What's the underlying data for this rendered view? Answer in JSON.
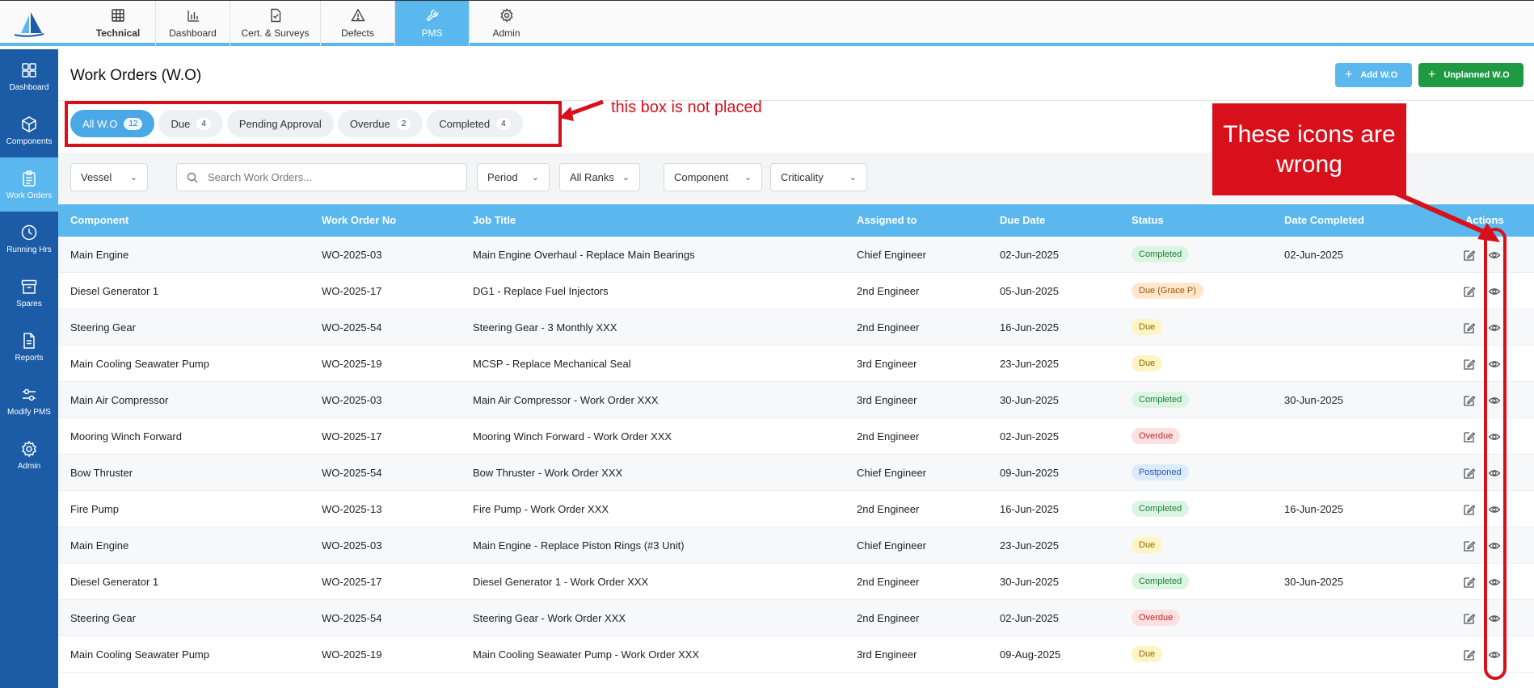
{
  "topnav": [
    {
      "label": "Technical",
      "icon": "grid-icon"
    },
    {
      "label": "Dashboard",
      "icon": "bar-chart-icon"
    },
    {
      "label": "Cert. & Surveys",
      "icon": "certificate-icon"
    },
    {
      "label": "Defects",
      "icon": "warning-icon"
    },
    {
      "label": "PMS",
      "icon": "wrench-icon",
      "active": true
    },
    {
      "label": "Admin",
      "icon": "gear-icon"
    }
  ],
  "sidebar": [
    {
      "label": "Dashboard",
      "icon": "dashboard-icon"
    },
    {
      "label": "Components",
      "icon": "cube-icon"
    },
    {
      "label": "Work Orders",
      "icon": "clipboard-icon",
      "active": true
    },
    {
      "label": "Running Hrs",
      "icon": "clock-icon"
    },
    {
      "label": "Spares",
      "icon": "archive-icon"
    },
    {
      "label": "Reports",
      "icon": "document-icon"
    },
    {
      "label": "Modify PMS",
      "icon": "sliders-icon"
    },
    {
      "label": "Admin",
      "icon": "gear-icon"
    }
  ],
  "page": {
    "title": "Work Orders (W.O)",
    "add_button": "Add W.O",
    "unplanned_button": "Unplanned W.O"
  },
  "tabs": [
    {
      "label": "All W.O",
      "count": "12",
      "active": true
    },
    {
      "label": "Due",
      "count": "4"
    },
    {
      "label": "Pending Approval",
      "count": ""
    },
    {
      "label": "Overdue",
      "count": "2"
    },
    {
      "label": "Completed",
      "count": "4"
    }
  ],
  "filters": {
    "vessel": "Vessel",
    "search_placeholder": "Search Work Orders...",
    "period": "Period",
    "ranks": "All Ranks",
    "component": "Component",
    "criticality": "Criticality"
  },
  "annotations": {
    "box_note": "this box is not placed",
    "icons_note_line1": "These icons are",
    "icons_note_line2": "wrong"
  },
  "table": {
    "headers": [
      "Component",
      "Work Order No",
      "Job Title",
      "Assigned to",
      "Due Date",
      "Status",
      "Date Completed",
      "Actions"
    ],
    "rows": [
      [
        "Main Engine",
        "WO-2025-03",
        "Main Engine Overhaul - Replace Main Bearings",
        "Chief Engineer",
        "02-Jun-2025",
        "Completed",
        "02-Jun-2025"
      ],
      [
        "Diesel Generator 1",
        "WO-2025-17",
        "DG1 - Replace Fuel Injectors",
        "2nd Engineer",
        "05-Jun-2025",
        "Due (Grace P)",
        ""
      ],
      [
        "Steering Gear",
        "WO-2025-54",
        "Steering Gear - 3 Monthly XXX",
        "2nd Engineer",
        "16-Jun-2025",
        "Due",
        ""
      ],
      [
        "Main Cooling Seawater Pump",
        "WO-2025-19",
        "MCSP - Replace Mechanical Seal",
        "3rd Engineer",
        "23-Jun-2025",
        "Due",
        ""
      ],
      [
        "Main Air Compressor",
        "WO-2025-03",
        "Main Air Compressor - Work Order XXX",
        "3rd Engineer",
        "30-Jun-2025",
        "Completed",
        "30-Jun-2025"
      ],
      [
        "Mooring Winch Forward",
        "WO-2025-17",
        "Mooring Winch Forward - Work Order XXX",
        "2nd Engineer",
        "02-Jun-2025",
        "Overdue",
        ""
      ],
      [
        "Bow Thruster",
        "WO-2025-54",
        "Bow Thruster - Work Order XXX",
        "Chief Engineer",
        "09-Jun-2025",
        "Postponed",
        ""
      ],
      [
        "Fire Pump",
        "WO-2025-13",
        "Fire Pump - Work Order XXX",
        "2nd Engineer",
        "16-Jun-2025",
        "Completed",
        "16-Jun-2025"
      ],
      [
        "Main Engine",
        "WO-2025-03",
        "Main Engine - Replace Piston Rings (#3 Unit)",
        "Chief Engineer",
        "23-Jun-2025",
        "Due",
        ""
      ],
      [
        "Diesel Generator 1",
        "WO-2025-17",
        "Diesel Generator 1 - Work Order XXX",
        "2nd Engineer",
        "30-Jun-2025",
        "Completed",
        "30-Jun-2025"
      ],
      [
        "Steering Gear",
        "WO-2025-54",
        "Steering Gear - Work Order XXX",
        "2nd Engineer",
        "02-Jun-2025",
        "Overdue",
        ""
      ],
      [
        "Main Cooling Seawater Pump",
        "WO-2025-19",
        "Main Cooling Seawater Pump - Work Order XXX",
        "3rd Engineer",
        "09-Aug-2025",
        "Due",
        ""
      ]
    ]
  },
  "colors": {
    "accent": "#5ab8ee",
    "sidebar": "#1c5ca7",
    "success": "#1f9a43",
    "annotation": "#d8101b"
  }
}
